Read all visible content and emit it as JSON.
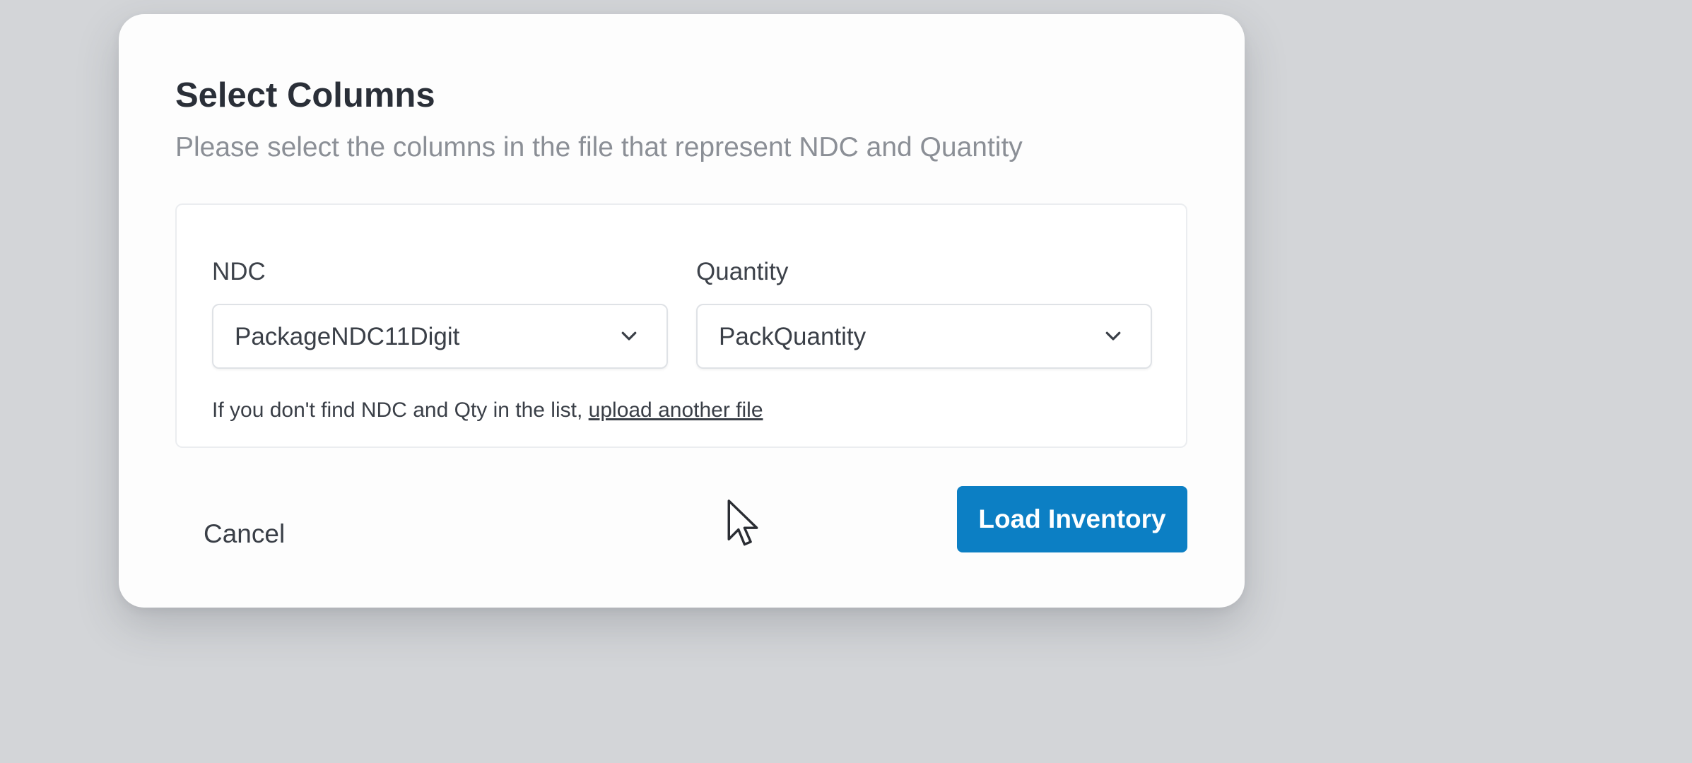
{
  "dialog": {
    "title": "Select Columns",
    "subtitle": "Please select the columns in the file that represent NDC and Quantity"
  },
  "fields": {
    "ndc": {
      "label": "NDC",
      "selected": "PackageNDC11Digit",
      "icon": "chevron-down-icon"
    },
    "quantity": {
      "label": "Quantity",
      "selected": "PackQuantity",
      "icon": "chevron-down-icon"
    }
  },
  "hint": {
    "text": "If you don't find NDC and Qty in the list, ",
    "link": "upload another file"
  },
  "actions": {
    "cancel_label": "Cancel",
    "primary_label": "Load Inventory"
  },
  "colors": {
    "backdrop": "#d3d5d8",
    "dialog_background": "#fdfdfd",
    "primary": "#0c7fc4",
    "title_text": "#2a2f38",
    "subtitle_text": "#8b8f96"
  },
  "cursor": {
    "icon": "mouse-pointer-icon"
  }
}
